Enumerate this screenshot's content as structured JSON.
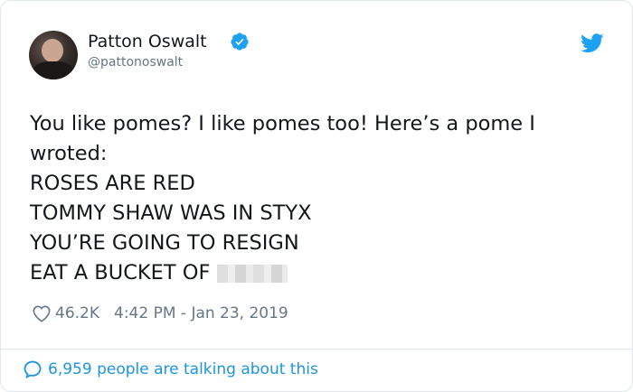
{
  "author": {
    "name": "Patton Oswalt",
    "handle": "@pattonoswalt",
    "verified": true
  },
  "tweet": {
    "lines": [
      "You like pomes? I like pomes too! Here’s a pome I",
      "wroted:",
      "ROSES ARE RED",
      "TOMMY SHAW WAS IN STYX",
      "YOU’RE GOING TO RESIGN",
      "EAT A BUCKET OF"
    ]
  },
  "meta": {
    "likes": "46.2K",
    "timestamp": "4:42 PM - Jan 23, 2019"
  },
  "footer": {
    "talking": "6,959 people are talking about this"
  },
  "icons": {
    "verified": "verified-badge-icon",
    "twitter": "twitter-bird-icon",
    "heart": "heart-outline-icon",
    "comment": "speech-bubble-icon"
  },
  "colors": {
    "accent": "#1da1f2",
    "link": "#1b95e0",
    "muted": "#657786",
    "text": "#14171a",
    "border": "#e1e8ed"
  }
}
